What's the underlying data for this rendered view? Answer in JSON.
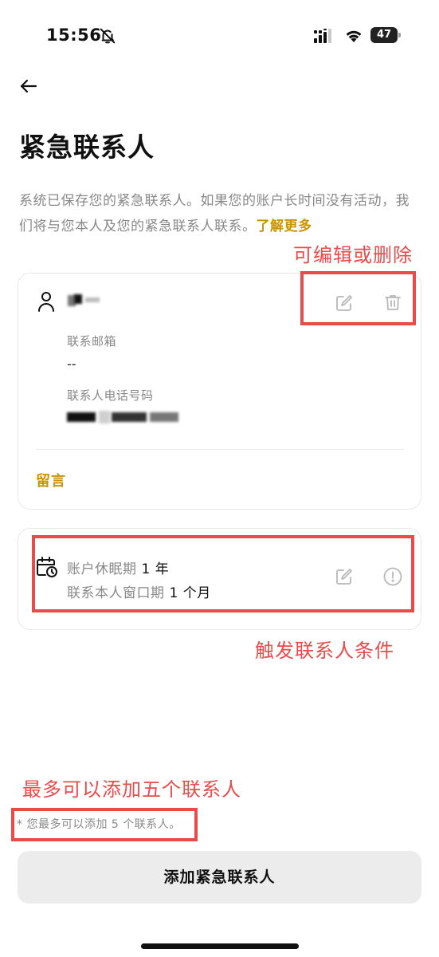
{
  "status_bar": {
    "time": "15:56",
    "battery": "47",
    "icons": [
      "bell-slash-icon",
      "signal-icon",
      "wifi-icon",
      "battery-icon"
    ]
  },
  "header": {
    "back_icon": "arrow-left-icon",
    "title": "紧急联系人"
  },
  "description": {
    "text": "系统已保存您的紧急联系人。如果您的账户长时间没有活动，我们将与您本人及您的紧急联系人联系。",
    "learn_more": "了解更多"
  },
  "contact_card": {
    "person_icon": "person-icon",
    "name": "",
    "actions": [
      "edit-icon",
      "trash-icon"
    ],
    "email_label": "联系邮箱",
    "email_value": "--",
    "phone_label": "联系人电话号码",
    "phone_value": "",
    "message_link": "留言"
  },
  "condition_card": {
    "calendar_icon": "calendar-clock-icon",
    "dormant_label": "账户休眠期",
    "dormant_value": "1 年",
    "window_label": "联系本人窗口期",
    "window_value": "1 个月",
    "actions": [
      "edit-icon",
      "info-icon"
    ]
  },
  "annotations": {
    "edit_delete": "可编辑或删除",
    "trigger": "触发联系人条件",
    "max_contacts": "最多可以添加五个联系人"
  },
  "footer": {
    "max_note": "* 您最多可以添加 5 个联系人。",
    "add_button": "添加紧急联系人"
  },
  "colors": {
    "accent": "#c99400",
    "annotation_red": "#ec4a4a",
    "button_bg": "#ececec",
    "muted_text": "#888888"
  }
}
